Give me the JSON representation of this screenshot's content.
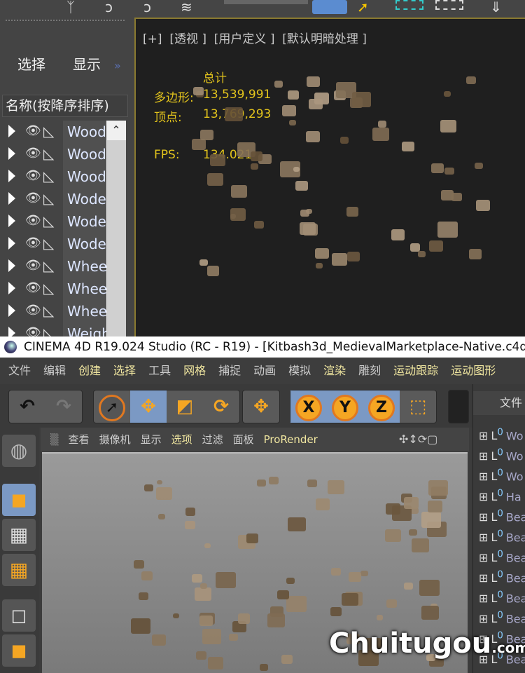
{
  "max": {
    "tabs": [
      "选择",
      "显示"
    ],
    "expand": "»",
    "column_header": "名称(按降序排序)",
    "rows": [
      "Wood",
      "Wood",
      "Wood",
      "Wode",
      "Wode",
      "Wode",
      "Whee",
      "Whee",
      "Whee",
      "Weigh"
    ],
    "viewport_labels": "[+]  [透视 ]  [用户定义 ]  [默认明暗处理 ]",
    "stats": {
      "header": "总计",
      "poly_label": "多边形:",
      "poly": "13,539,991",
      "vert_label": "顶点:",
      "vert": "13,769,293",
      "fps_label": "FPS:",
      "fps": "134.021"
    }
  },
  "c4d": {
    "title": "CINEMA 4D R19.024 Studio (RC - R19) - [Kitbash3d_MedievalMarketplace-Native.c4d",
    "menu": [
      {
        "t": "文件",
        "c": "#ccc"
      },
      {
        "t": "编辑",
        "c": "#ccc"
      },
      {
        "t": "创建",
        "c": "#f0e6a0"
      },
      {
        "t": "选择",
        "c": "#f0e6a0"
      },
      {
        "t": "工具",
        "c": "#ccc"
      },
      {
        "t": "网格",
        "c": "#f0e6a0"
      },
      {
        "t": "捕捉",
        "c": "#ccc"
      },
      {
        "t": "动画",
        "c": "#ccc"
      },
      {
        "t": "模拟",
        "c": "#ccc"
      },
      {
        "t": "渲染",
        "c": "#f0e6a0"
      },
      {
        "t": "雕刻",
        "c": "#ccc"
      },
      {
        "t": "运动跟踪",
        "c": "#f0e6a0"
      },
      {
        "t": "运动图形",
        "c": "#f0e6a0"
      }
    ],
    "axes": [
      "X",
      "Y",
      "Z"
    ],
    "viewport_menu": [
      "查看",
      "摄像机",
      "显示",
      "选项",
      "过滤",
      "面板",
      "ProRender"
    ],
    "om_header": "文件",
    "om_rows": [
      "Wo",
      "Wo",
      "Wo",
      "Ha",
      "Bea",
      "Bea",
      "Bea",
      "Bea",
      "Bea",
      "Bea",
      "Bea",
      "Bea"
    ],
    "layer_badge": "0"
  },
  "watermark": {
    "text": "huitugou",
    "suffix": ".com"
  }
}
